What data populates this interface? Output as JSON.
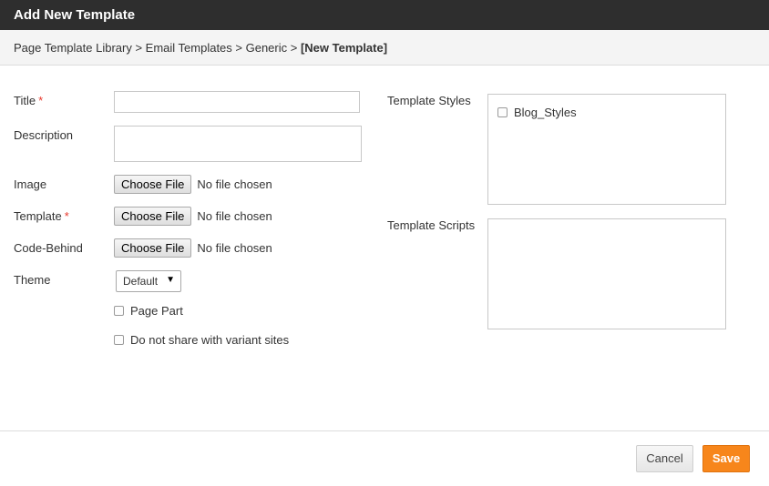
{
  "dialog": {
    "title": "Add New Template"
  },
  "breadcrumb": {
    "path": "Page Template Library > Email Templates > Generic > ",
    "current": "[New Template]"
  },
  "form": {
    "title_label": "Title",
    "title_value": "",
    "description_label": "Description",
    "description_value": "",
    "image_label": "Image",
    "template_label": "Template",
    "code_behind_label": "Code-Behind",
    "theme_label": "Theme",
    "theme_value": "Default",
    "page_part_label": "Page Part",
    "page_part_checked": false,
    "no_share_label": "Do not share with variant sites",
    "no_share_checked": false,
    "required_mark": "*",
    "choose_file_label": "Choose File",
    "no_file_label": "No file chosen"
  },
  "styles": {
    "label": "Template Styles",
    "items": [
      {
        "label": "Blog_Styles",
        "checked": false
      }
    ]
  },
  "scripts": {
    "label": "Template Scripts",
    "items": []
  },
  "footer": {
    "cancel_label": "Cancel",
    "save_label": "Save"
  },
  "colors": {
    "titlebar": "#2e2e2e",
    "required": "#e8382c",
    "save": "#f7861b"
  },
  "icons": {
    "select_arrow": "caret-down-icon"
  }
}
